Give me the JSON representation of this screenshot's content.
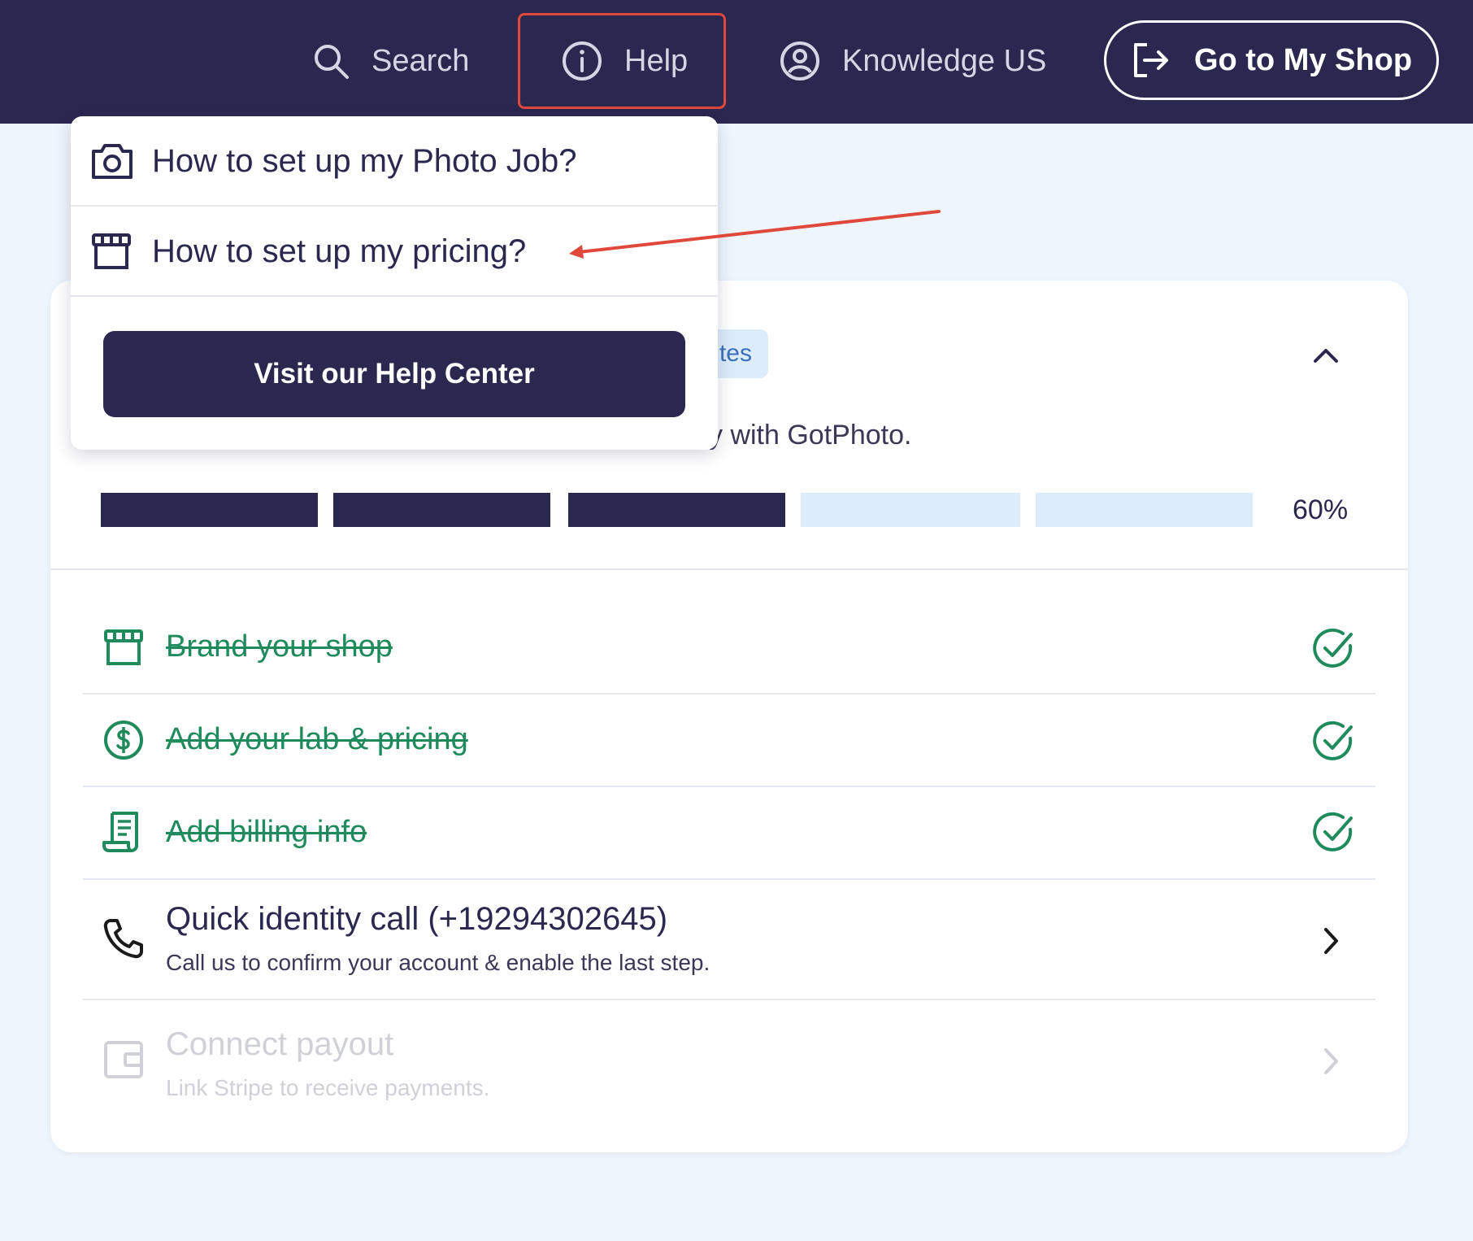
{
  "topbar": {
    "search_label": "Search",
    "help_label": "Help",
    "account_label": "Knowledge US",
    "shop_button_label": "Go to My Shop"
  },
  "help_menu": {
    "items": [
      {
        "label": "How to set up my Photo Job?",
        "icon": "camera-icon"
      },
      {
        "label": "How to set up my pricing?",
        "icon": "storefront-icon"
      }
    ],
    "help_center_button": "Visit our Help Center"
  },
  "onboarding": {
    "chip_text": "tes",
    "subtitle_fragment": "y with GotPhoto.",
    "progress_percent": 60,
    "progress_label": "60%",
    "progress_segments": 5,
    "progress_filled": 3,
    "tasks": [
      {
        "title": "Brand your shop",
        "done": true,
        "icon": "storefront-icon"
      },
      {
        "title": "Add your lab & pricing",
        "done": true,
        "icon": "dollar-circle-icon"
      },
      {
        "title": "Add billing info",
        "done": true,
        "icon": "receipt-icon"
      },
      {
        "title": "Quick identity call (+19294302645)",
        "subtitle": "Call us to confirm your account & enable the last step.",
        "done": false,
        "icon": "phone-icon"
      },
      {
        "title": "Connect payout",
        "subtitle": "Link Stripe to receive payments.",
        "done": false,
        "disabled": true,
        "icon": "wallet-icon"
      }
    ]
  },
  "colors": {
    "navy": "#2b2850",
    "done_green": "#1f8a5b",
    "highlight_red": "#e0483c",
    "progress_empty": "#dcecfb"
  }
}
